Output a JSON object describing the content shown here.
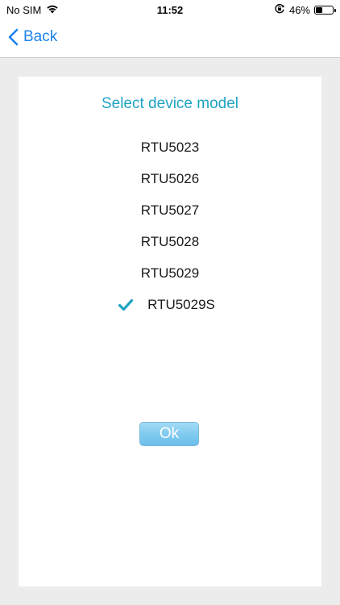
{
  "status_bar": {
    "carrier": "No SIM",
    "time": "11:52",
    "battery_percent": "46%",
    "battery_level": 0.46,
    "icons": [
      "wifi-icon",
      "orientation-lock-icon",
      "battery-icon"
    ]
  },
  "nav": {
    "back_label": "Back",
    "accent_color": "#1b82f1"
  },
  "dialog": {
    "title": "Select device model",
    "title_color": "#1fa3c4",
    "models": [
      "RTU5023",
      "RTU5026",
      "RTU5027",
      "RTU5028",
      "RTU5029",
      "RTU5029S"
    ],
    "selected_model": "RTU5029S",
    "ok_label": "Ok"
  }
}
